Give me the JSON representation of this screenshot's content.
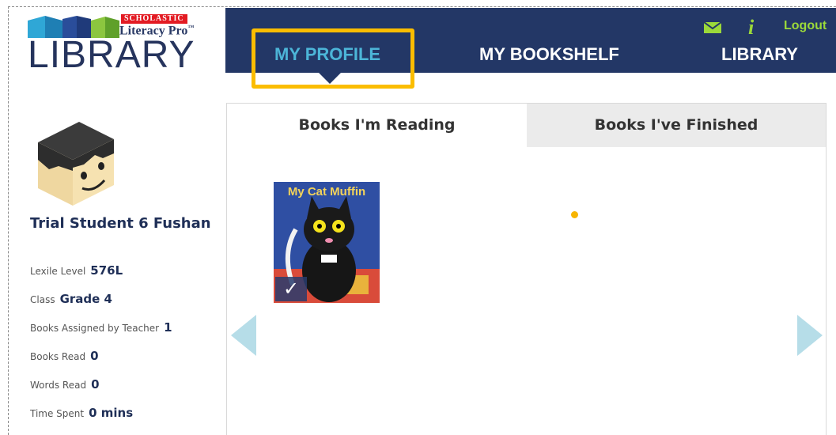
{
  "brand": {
    "publisher": "SCHOLASTIC",
    "product": "Literacy Pro",
    "trademark": "™",
    "name": "LIBRARY"
  },
  "nav": {
    "items": [
      {
        "label": "MY PROFILE",
        "active": true
      },
      {
        "label": "MY BOOKSHELF",
        "active": false
      },
      {
        "label": "LIBRARY",
        "active": false
      }
    ],
    "logout_label": "Logout",
    "mail_icon": "mail-icon",
    "info_icon": "info-icon",
    "info_glyph": "i"
  },
  "profile": {
    "name": "Trial Student 6 Fushan",
    "stats": [
      {
        "label": "Lexile Level",
        "value": "576L"
      },
      {
        "label": "Class",
        "value": "Grade 4"
      },
      {
        "label": "Books Assigned by Teacher",
        "value": "1"
      },
      {
        "label": "Books Read",
        "value": "0"
      },
      {
        "label": "Words Read",
        "value": "0"
      },
      {
        "label": "Time Spent",
        "value": "0 mins"
      }
    ]
  },
  "tabs": [
    {
      "label": "Books I'm Reading",
      "selected": true
    },
    {
      "label": "Books I've Finished",
      "selected": false
    }
  ],
  "books": [
    {
      "title": "My Cat Muffin",
      "checked": true,
      "check_glyph": "✓"
    }
  ],
  "colors": {
    "navbar": "#233766",
    "active_nav": "#4cb5d8",
    "highlight": "#fbbd00",
    "util_green": "#9bd93a",
    "carousel_arrow": "#b6dde8"
  }
}
